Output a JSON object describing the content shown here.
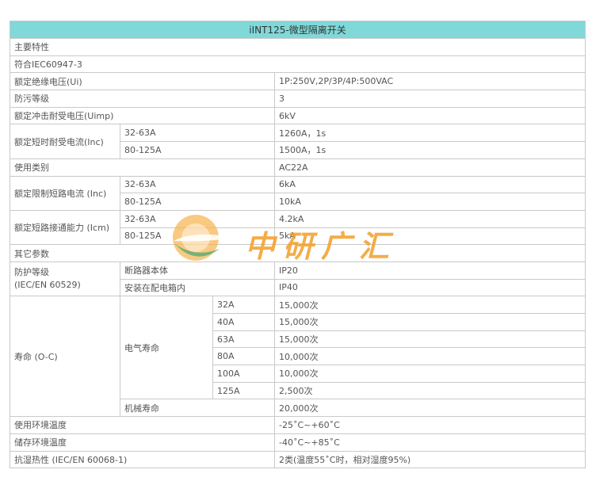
{
  "title": "iINT125-微型隔离开关",
  "rows": {
    "main_features": "主要特性",
    "standard": "符合IEC60947-3",
    "rated_insulation_voltage": {
      "label": "额定绝缘电压(Ui)",
      "value": "1P:250V,2P/3P/4P:500VAC"
    },
    "pollution_degree": {
      "label": "防污等级",
      "value": "3"
    },
    "impulse_voltage": {
      "label": "额定冲击耐受电压(Uimp)",
      "value": "6kV"
    },
    "short_time_current": {
      "label": "额定短时耐受电流(Inc)",
      "items": [
        {
          "range": "32-63A",
          "value": "1260A，1s"
        },
        {
          "range": "80-125A",
          "value": "1500A，1s"
        }
      ]
    },
    "utilization_category": {
      "label": "使用类别",
      "value": "AC22A"
    },
    "limited_sc_current": {
      "label": "额定限制短路电流 (Inc)",
      "items": [
        {
          "range": "32-63A",
          "value": "6kA"
        },
        {
          "range": "80-125A",
          "value": "10kA"
        }
      ]
    },
    "sc_making_capacity": {
      "label": "额定短路接通能力 (Icm)",
      "items": [
        {
          "range": "32-63A",
          "value": "4.2kA"
        },
        {
          "range": "80-125A",
          "value": "5kA"
        }
      ]
    },
    "other_params": "其它参数",
    "protection": {
      "label_line1": "防护等级",
      "label_line2": "(IEC/EN 60529)",
      "items": [
        {
          "name": "断路器本体",
          "value": "IP20"
        },
        {
          "name": "安装在配电箱内",
          "value": "IP40"
        }
      ]
    },
    "life": {
      "label": "寿命 (O-C)",
      "electrical": {
        "label": "电气寿命",
        "items": [
          {
            "rating": "32A",
            "value": "15,000次"
          },
          {
            "rating": "40A",
            "value": "15,000次"
          },
          {
            "rating": "63A",
            "value": "15,000次"
          },
          {
            "rating": "80A",
            "value": "10,000次"
          },
          {
            "rating": "100A",
            "value": "10,000次"
          },
          {
            "rating": "125A",
            "value": "2,500次"
          }
        ]
      },
      "mechanical": {
        "label": "机械寿命",
        "value": "20,000次"
      }
    },
    "operating_temp": {
      "label": "使用环境温度",
      "value": "-25˚C~+60˚C"
    },
    "storage_temp": {
      "label": "储存环境温度",
      "value": "-40˚C~+85˚C"
    },
    "damp_heat": {
      "label": "抗湿热性 (IEC/EN 60068-1)",
      "value": "2类(温度55˚C时，相对湿度95%)"
    }
  },
  "watermark": {
    "text": "中研广汇",
    "colors": {
      "orange": "#f39a1f",
      "green": "#3d9a5a",
      "teal_header": "#80d8d9"
    }
  }
}
